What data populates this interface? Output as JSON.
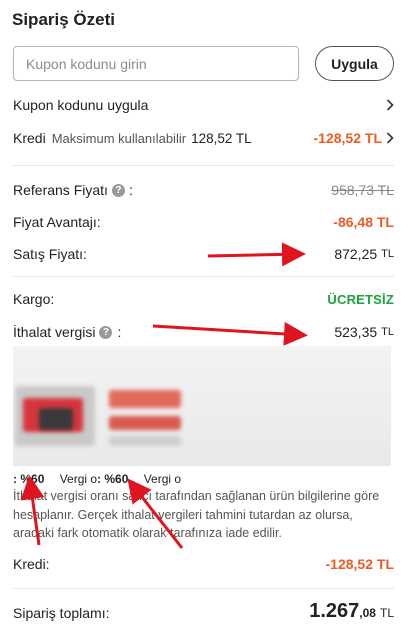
{
  "summary": {
    "title": "Sipariş Özeti"
  },
  "coupon": {
    "placeholder": "Kupon kodunu girin",
    "apply_label": "Uygula",
    "apply_row_label": "Kupon kodunu uygula"
  },
  "credit_row": {
    "label": "Kredi",
    "sub_label": "Maksimum kullanılabilir",
    "available": "128,52 TL",
    "value": "-128,52 TL"
  },
  "reference_price": {
    "label": "Referans Fiyatı",
    "value": "958,73 TL"
  },
  "price_advantage": {
    "label": "Fiyat Avantajı:",
    "value": "-86,48 TL"
  },
  "sale_price": {
    "label": "Satış Fiyatı:",
    "amount": "872,25",
    "currency": "TL"
  },
  "shipping": {
    "label": "Kargo:",
    "value": "ÜCRETSİZ"
  },
  "import_tax": {
    "label": "İthalat vergisi",
    "amount": "523,35",
    "currency": "TL",
    "rate_tags": [
      "%60",
      "%60"
    ],
    "tag_suffix": "Vergi o",
    "description": "İthalat vergisi oranı satıcı tarafından sağlanan ürün bilgilerine göre hesaplanır. Gerçek ithalat vergileri tahmini tutardan az olursa, aradaki fark otomatik olarak tarafınıza iade edilir."
  },
  "credit_bottom": {
    "label": "Kredi:",
    "value": "-128,52 TL"
  },
  "order_total": {
    "label": "Sipariş toplamı:",
    "integer": "1.267",
    "decimal": ",08",
    "currency": "TL"
  },
  "colors": {
    "accent_orange": "#f05a22",
    "free_green": "#1aa33a",
    "annotation_red": "#e0141e"
  },
  "icons": {
    "chevron": "chevron-right-icon",
    "help": "question-mark-icon"
  }
}
